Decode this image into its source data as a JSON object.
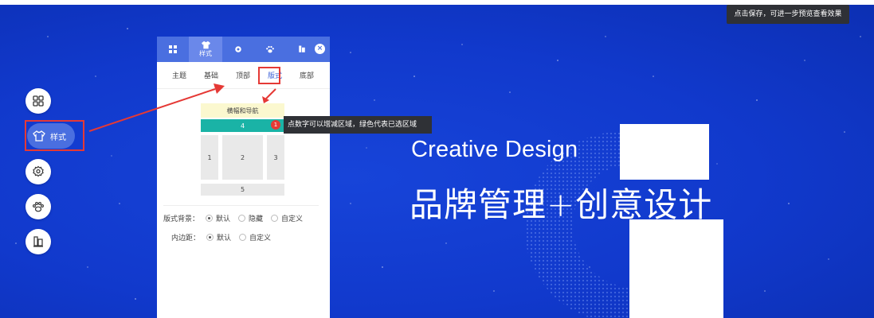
{
  "save_tooltip": "点击保存，可进一步预览查看效果",
  "hero": {
    "english": "Creative Design",
    "chinese": "品牌管理+创意设计"
  },
  "dock": {
    "active_label": "样式",
    "icons": [
      "grid-icon",
      "shirt-icon",
      "gear-icon",
      "paw-icon",
      "book-icon"
    ]
  },
  "panel": {
    "top_tabs": [
      {
        "icon": "grid-icon",
        "label": ""
      },
      {
        "icon": "shirt-icon",
        "label": "样式"
      },
      {
        "icon": "gear-icon",
        "label": ""
      },
      {
        "icon": "paw-icon",
        "label": ""
      },
      {
        "icon": "book-icon",
        "label": ""
      }
    ],
    "close_label": "×",
    "sub_tabs": [
      "主题",
      "基础",
      "顶部",
      "版式",
      "底部"
    ],
    "active_sub_tab": "版式",
    "layout": {
      "banner": "横幅和导航",
      "block4": "4",
      "block1": "1",
      "block2": "2",
      "block3": "3",
      "block5": "5"
    },
    "badge_number": "1",
    "layout_tip": "点数字可以增减区域，绿色代表已选区域",
    "options": [
      {
        "label": "版式背景：",
        "choices": [
          "默认",
          "隐藏",
          "自定义"
        ],
        "selected": "默认"
      },
      {
        "label": "内边距：",
        "choices": [
          "默认",
          "自定义"
        ],
        "selected": "默认"
      }
    ]
  },
  "colors": {
    "background": "#1139cc",
    "panel_header": "#4a6fe0",
    "highlight_green": "#1ab3a6",
    "banner_yellow": "#fbf8cf",
    "annotation_red": "#e53935"
  }
}
